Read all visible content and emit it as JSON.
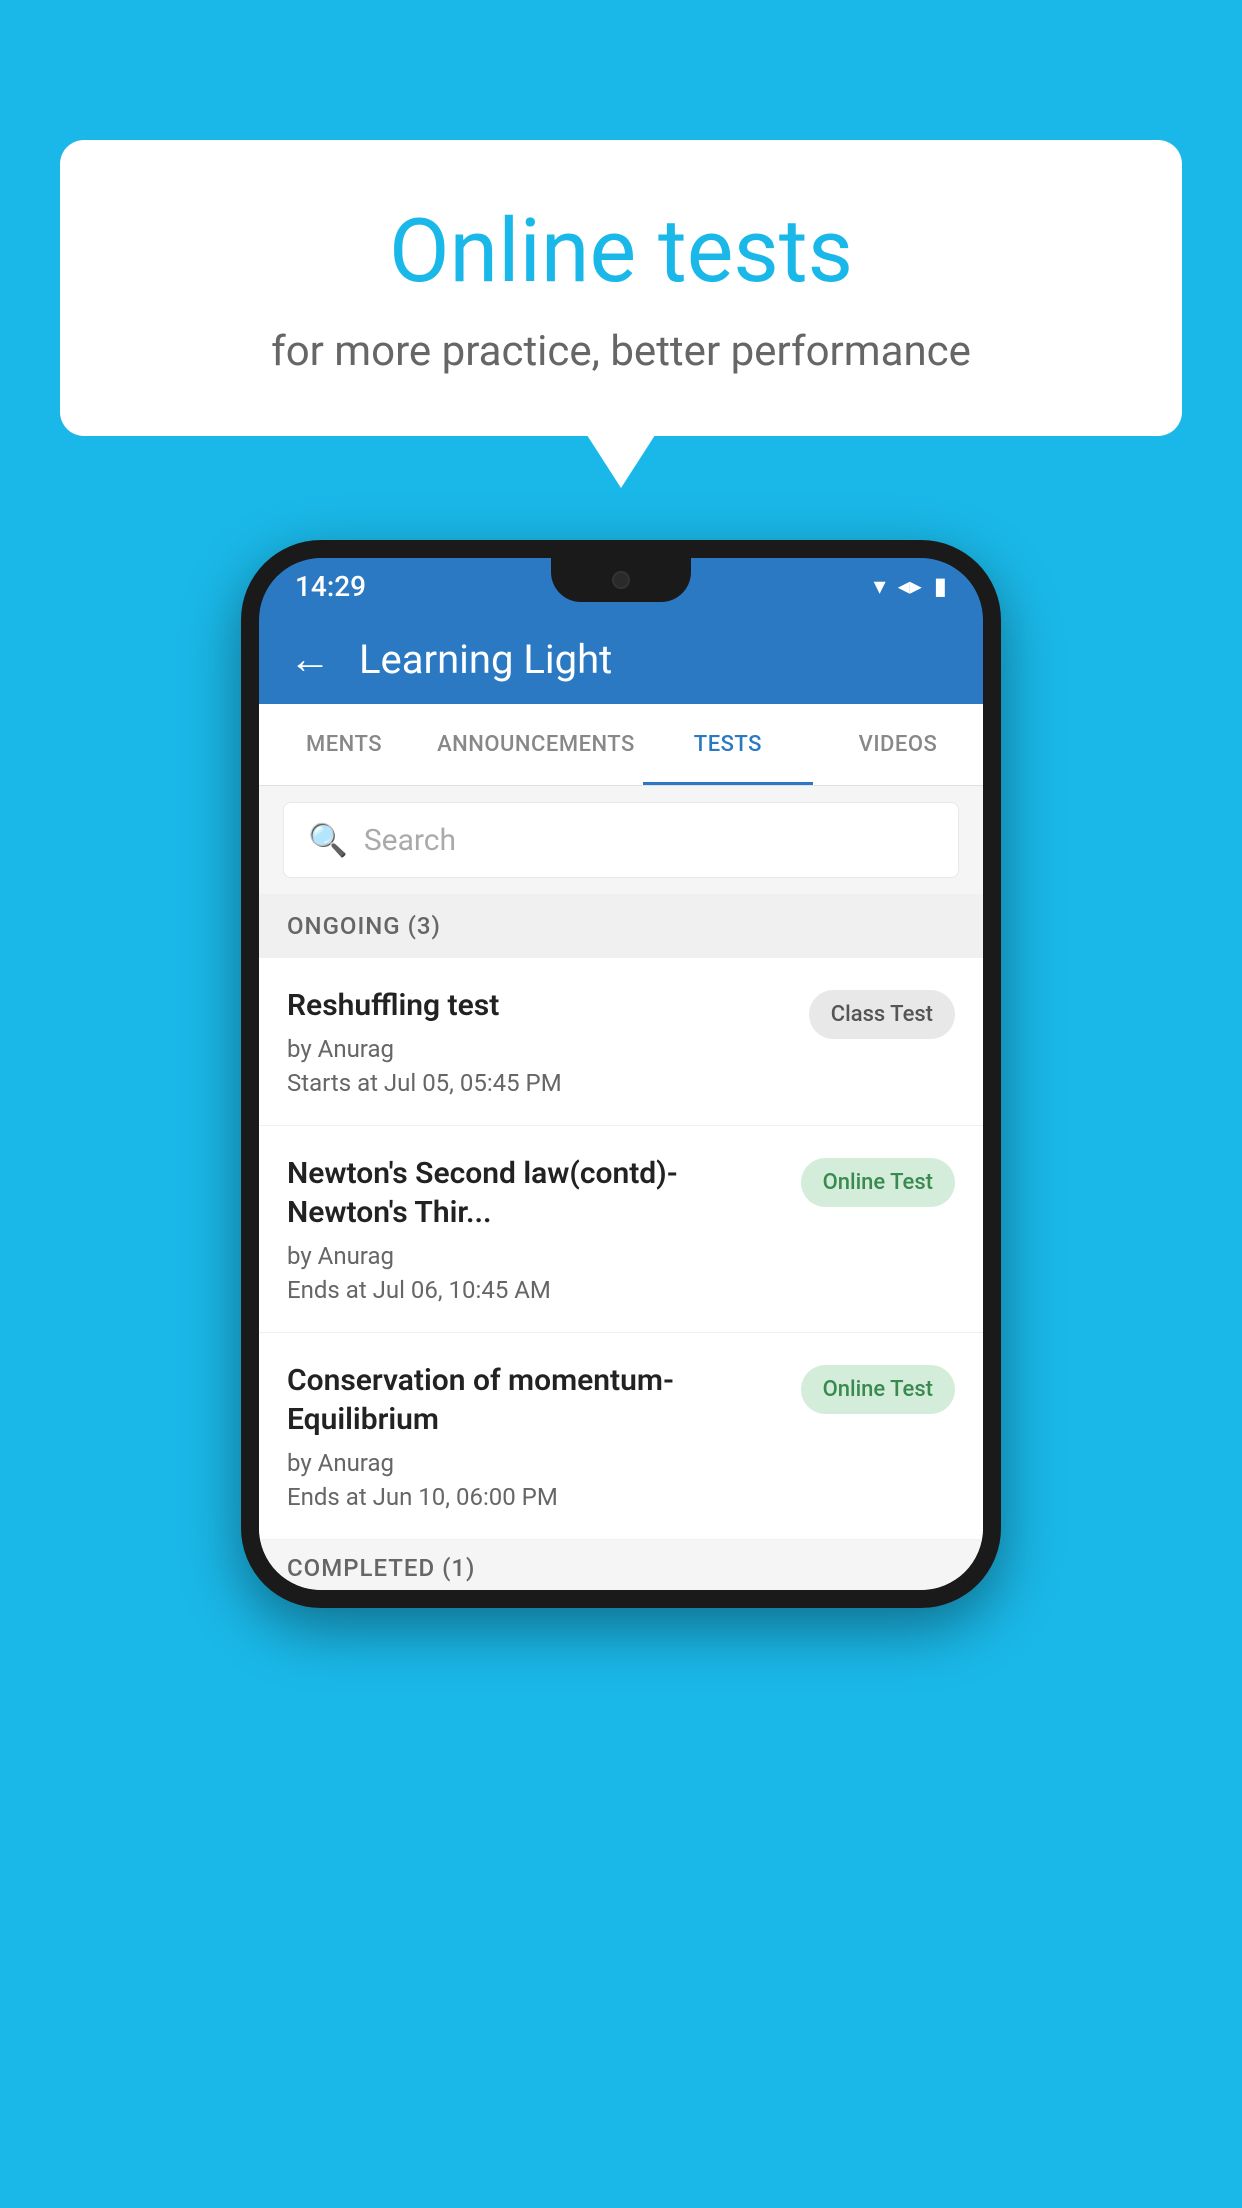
{
  "background_color": "#1ab8e8",
  "bubble": {
    "title": "Online tests",
    "subtitle": "for more practice, better performance"
  },
  "phone": {
    "status_bar": {
      "time": "14:29",
      "wifi": "▾",
      "signal": "▲",
      "battery": "▮"
    },
    "header": {
      "back_label": "←",
      "title": "Learning Light"
    },
    "tabs": [
      {
        "label": "MENTS",
        "active": false
      },
      {
        "label": "ANNOUNCEMENTS",
        "active": false
      },
      {
        "label": "TESTS",
        "active": true
      },
      {
        "label": "VIDEOS",
        "active": false
      }
    ],
    "search": {
      "placeholder": "Search"
    },
    "ongoing_section": {
      "label": "ONGOING (3)"
    },
    "tests": [
      {
        "name": "Reshuffling test",
        "by": "by Anurag",
        "time": "Starts at  Jul 05, 05:45 PM",
        "badge": "Class Test",
        "badge_type": "class"
      },
      {
        "name": "Newton's Second law(contd)-Newton's Thir...",
        "by": "by Anurag",
        "time": "Ends at  Jul 06, 10:45 AM",
        "badge": "Online Test",
        "badge_type": "online"
      },
      {
        "name": "Conservation of momentum-Equilibrium",
        "by": "by Anurag",
        "time": "Ends at  Jun 10, 06:00 PM",
        "badge": "Online Test",
        "badge_type": "online"
      }
    ],
    "completed_section": {
      "label": "COMPLETED (1)"
    }
  }
}
